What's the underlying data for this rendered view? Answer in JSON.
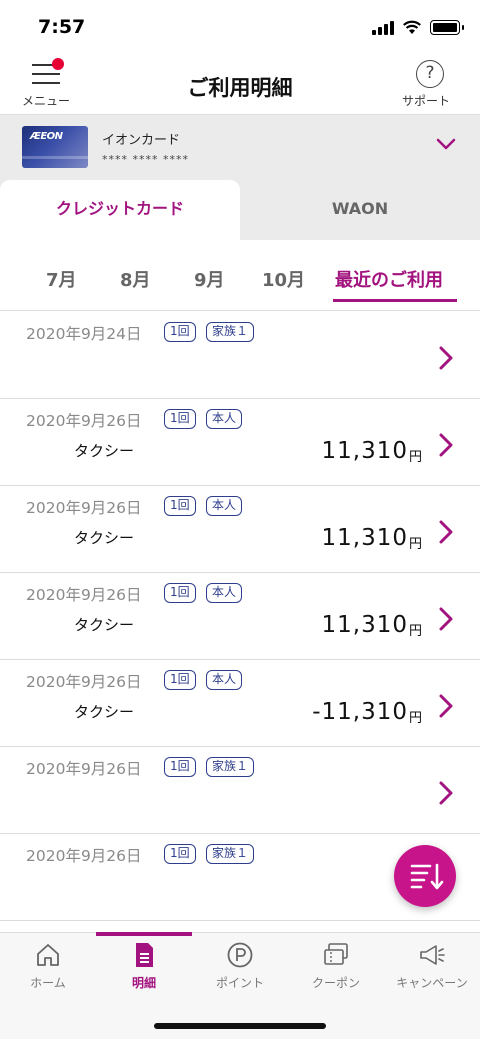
{
  "status_bar": {
    "time": "7:57"
  },
  "header": {
    "menu_label": "メニュー",
    "title": "ご利用明細",
    "support_label": "サポート"
  },
  "card": {
    "logo": "ÆEON",
    "name": "イオンカード",
    "number_masked": "**** **** ****"
  },
  "tabs": [
    {
      "label": "クレジットカード",
      "active": true
    },
    {
      "label": "WAON",
      "active": false
    }
  ],
  "months": [
    "7月",
    "8月",
    "9月",
    "10月",
    "最近のご利用"
  ],
  "transactions": [
    {
      "date": "2020年9月24日",
      "count": "1回",
      "holder": "家族１",
      "merchant": "",
      "amount": "",
      "yen": ""
    },
    {
      "date": "2020年9月26日",
      "count": "1回",
      "holder": "本人",
      "merchant": "タクシー",
      "amount": "11,310",
      "yen": "円"
    },
    {
      "date": "2020年9月26日",
      "count": "1回",
      "holder": "本人",
      "merchant": "タクシー",
      "amount": "11,310",
      "yen": "円"
    },
    {
      "date": "2020年9月26日",
      "count": "1回",
      "holder": "本人",
      "merchant": "タクシー",
      "amount": "11,310",
      "yen": "円"
    },
    {
      "date": "2020年9月26日",
      "count": "1回",
      "holder": "本人",
      "merchant": "タクシー",
      "amount": "-11,310",
      "yen": "円"
    },
    {
      "date": "2020年9月26日",
      "count": "1回",
      "holder": "家族１",
      "merchant": "",
      "amount": "",
      "yen": ""
    },
    {
      "date": "2020年9月26日",
      "count": "1回",
      "holder": "家族１",
      "merchant": "",
      "amount": "",
      "yen": ""
    }
  ],
  "bottom_nav": [
    {
      "label": "ホーム",
      "icon": "home-icon"
    },
    {
      "label": "明細",
      "icon": "statement-icon",
      "active": true
    },
    {
      "label": "ポイント",
      "icon": "point-icon"
    },
    {
      "label": "クーポン",
      "icon": "coupon-icon"
    },
    {
      "label": "キャンペーン",
      "icon": "campaign-icon"
    }
  ],
  "colors": {
    "accent": "#a3137f",
    "fab": "#c8148a",
    "badge": "#2e3e8c",
    "notification_dot": "#e60033"
  }
}
